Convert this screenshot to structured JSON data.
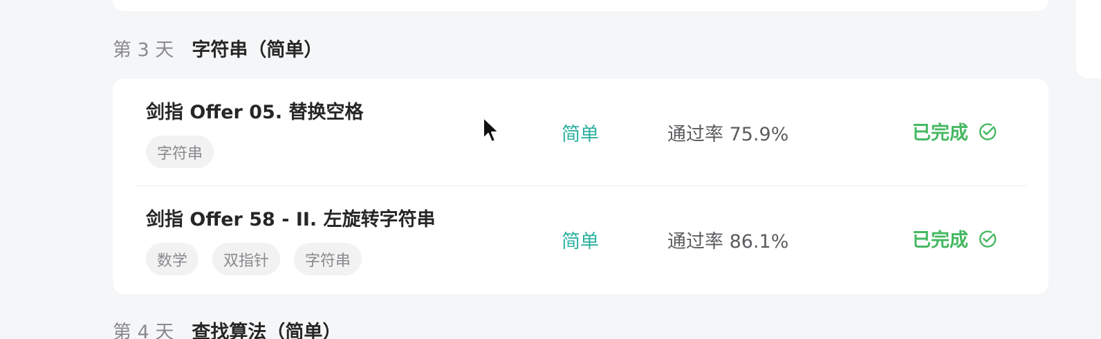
{
  "sections": [
    {
      "day_label": "第 3 天",
      "title": "字符串（简单）",
      "problems": [
        {
          "title": "剑指 Offer 05. 替换空格",
          "tags": [
            "字符串"
          ],
          "difficulty": "简单",
          "pass_rate": "通过率 75.9%",
          "status": "已完成",
          "status_icon": "check-circle-icon"
        },
        {
          "title": "剑指 Offer 58 - II. 左旋转字符串",
          "tags": [
            "数学",
            "双指针",
            "字符串"
          ],
          "difficulty": "简单",
          "pass_rate": "通过率 86.1%",
          "status": "已完成",
          "status_icon": "check-circle-icon"
        }
      ]
    },
    {
      "day_label": "第 4 天",
      "title": "查找算法（简单）"
    }
  ],
  "colors": {
    "background": "#f5f6f7",
    "card": "#ffffff",
    "difficulty_easy": "#2db0a0",
    "completed": "#45b861",
    "muted_text": "#8a8a8e",
    "tag_background": "#f2f2f3"
  }
}
